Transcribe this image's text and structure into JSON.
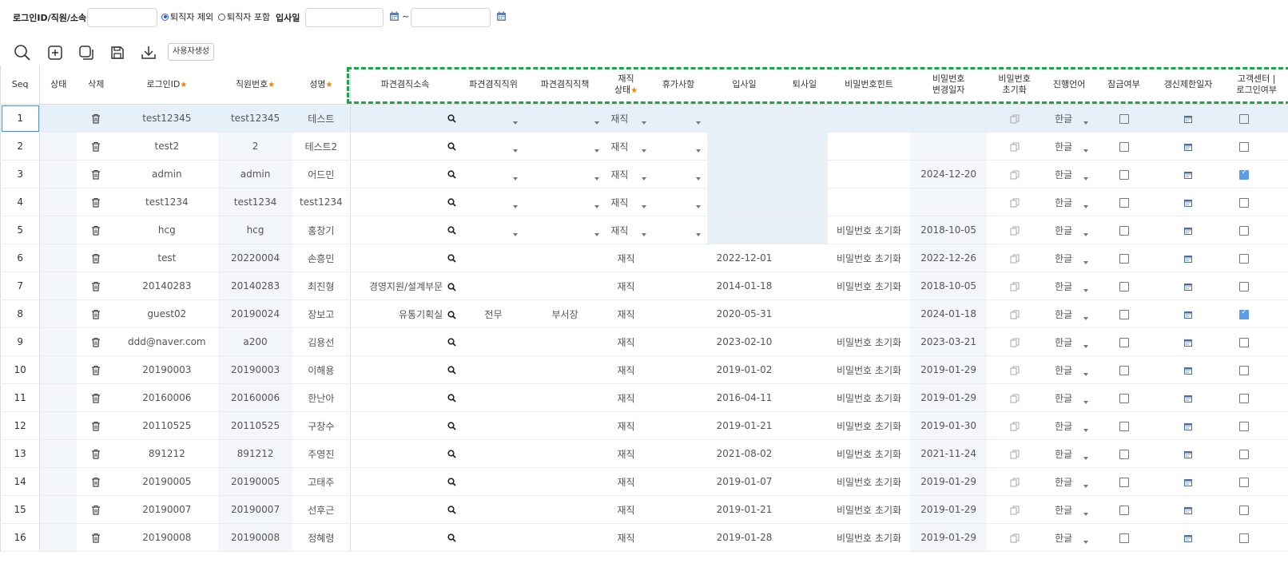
{
  "filters": {
    "login_label": "로그인ID/직원/소속",
    "login_value": "",
    "retired_exclude": "퇴직자 제외",
    "retired_include": "퇴직자 포함",
    "hire_label": "입사일",
    "date_from": "",
    "date_to": "",
    "tilde": "~"
  },
  "toolbar": {
    "create_user": "사용자생성"
  },
  "columns": {
    "seq": "Seq",
    "status": "상태",
    "delete": "삭제",
    "login_id": "로그인ID",
    "emp_no": "직원번호",
    "name": "성명",
    "dispatch_org": "파견겸직소속",
    "dispatch_pos": "파견겸직직위",
    "dispatch_duty": "파견겸직직책",
    "work_status_1": "재직",
    "work_status_2": "상태",
    "leave": "휴가사항",
    "hire_date": "입사일",
    "retire_date": "퇴사일",
    "pw_hint": "비밀번호힌트",
    "pw_changed_1": "비밀번호",
    "pw_changed_2": "변경일자",
    "pw_reset_1": "비밀번호",
    "pw_reset_2": "초기화",
    "language": "진행언어",
    "lock": "잠금여부",
    "renew_limit": "갱신제한일자",
    "cs_login_1": "고객센터 |",
    "cs_login_2": "로그인여부"
  },
  "rows": [
    {
      "seq": "1",
      "login": "test12345",
      "emp": "test12345",
      "name": "테스트",
      "org": "",
      "pos": "",
      "duty": "",
      "status": "재직",
      "hire": "",
      "hint": "",
      "pwdate": "",
      "lang": "한글",
      "cs": false,
      "editable": true
    },
    {
      "seq": "2",
      "login": "test2",
      "emp": "2",
      "name": "테스트2",
      "org": "",
      "pos": "",
      "duty": "",
      "status": "재직",
      "hire": "",
      "hint": "",
      "pwdate": "",
      "lang": "한글",
      "cs": false,
      "editable": true
    },
    {
      "seq": "3",
      "login": "admin",
      "emp": "admin",
      "name": "어드민",
      "org": "",
      "pos": "",
      "duty": "",
      "status": "재직",
      "hire": "",
      "hint": "",
      "pwdate": "2024-12-20",
      "lang": "한글",
      "cs": true,
      "editable": true
    },
    {
      "seq": "4",
      "login": "test1234",
      "emp": "test1234",
      "name": "test1234",
      "org": "",
      "pos": "",
      "duty": "",
      "status": "재직",
      "hire": "",
      "hint": "",
      "pwdate": "",
      "lang": "한글",
      "cs": false,
      "editable": true
    },
    {
      "seq": "5",
      "login": "hcg",
      "emp": "hcg",
      "name": "홍창기",
      "org": "",
      "pos": "",
      "duty": "",
      "status": "재직",
      "hire": "",
      "hint": "비밀번호 초기화",
      "pwdate": "2018-10-05",
      "lang": "한글",
      "cs": false,
      "editable": true
    },
    {
      "seq": "6",
      "login": "test",
      "emp": "20220004",
      "name": "손흥민",
      "org": "",
      "pos": "",
      "duty": "",
      "status": "재직",
      "hire": "2022-12-01",
      "hint": "비밀번호 초기화",
      "pwdate": "2022-12-26",
      "lang": "한글",
      "cs": false,
      "editable": false
    },
    {
      "seq": "7",
      "login": "20140283",
      "emp": "20140283",
      "name": "최진형",
      "org": "경영지원/설계부문",
      "pos": "",
      "duty": "",
      "status": "재직",
      "hire": "2014-01-18",
      "hint": "비밀번호 초기화",
      "pwdate": "2018-10-05",
      "lang": "한글",
      "cs": false,
      "editable": false
    },
    {
      "seq": "8",
      "login": "guest02",
      "emp": "20190024",
      "name": "장보고",
      "org": "유통기획실",
      "pos": "전무",
      "duty": "부서장",
      "status": "재직",
      "hire": "2020-05-31",
      "hint": "",
      "pwdate": "2024-01-18",
      "lang": "한글",
      "cs": true,
      "editable": false
    },
    {
      "seq": "9",
      "login": "ddd@naver.com",
      "emp": "a200",
      "name": "김용선",
      "org": "",
      "pos": "",
      "duty": "",
      "status": "재직",
      "hire": "2023-02-10",
      "hint": "비밀번호 초기화",
      "pwdate": "2023-03-21",
      "lang": "한글",
      "cs": false,
      "editable": false
    },
    {
      "seq": "10",
      "login": "20190003",
      "emp": "20190003",
      "name": "이해용",
      "org": "",
      "pos": "",
      "duty": "",
      "status": "재직",
      "hire": "2019-01-02",
      "hint": "비밀번호 초기화",
      "pwdate": "2019-01-29",
      "lang": "한글",
      "cs": false,
      "editable": false
    },
    {
      "seq": "11",
      "login": "20160006",
      "emp": "20160006",
      "name": "한난아",
      "org": "",
      "pos": "",
      "duty": "",
      "status": "재직",
      "hire": "2016-04-11",
      "hint": "비밀번호 초기화",
      "pwdate": "2019-01-29",
      "lang": "한글",
      "cs": false,
      "editable": false
    },
    {
      "seq": "12",
      "login": "20110525",
      "emp": "20110525",
      "name": "구창수",
      "org": "",
      "pos": "",
      "duty": "",
      "status": "재직",
      "hire": "2019-01-21",
      "hint": "비밀번호 초기화",
      "pwdate": "2019-01-30",
      "lang": "한글",
      "cs": false,
      "editable": false
    },
    {
      "seq": "13",
      "login": "891212",
      "emp": "891212",
      "name": "주영진",
      "org": "",
      "pos": "",
      "duty": "",
      "status": "재직",
      "hire": "2021-08-02",
      "hint": "비밀번호 초기화",
      "pwdate": "2021-11-24",
      "lang": "한글",
      "cs": false,
      "editable": false
    },
    {
      "seq": "14",
      "login": "20190005",
      "emp": "20190005",
      "name": "고태주",
      "org": "",
      "pos": "",
      "duty": "",
      "status": "재직",
      "hire": "2019-01-07",
      "hint": "비밀번호 초기화",
      "pwdate": "2019-01-29",
      "lang": "한글",
      "cs": false,
      "editable": false
    },
    {
      "seq": "15",
      "login": "20190007",
      "emp": "20190007",
      "name": "선후근",
      "org": "",
      "pos": "",
      "duty": "",
      "status": "재직",
      "hire": "2019-01-21",
      "hint": "비밀번호 초기화",
      "pwdate": "2019-01-29",
      "lang": "한글",
      "cs": false,
      "editable": false
    },
    {
      "seq": "16",
      "login": "20190008",
      "emp": "20190008",
      "name": "정혜령",
      "org": "",
      "pos": "",
      "duty": "",
      "status": "재직",
      "hire": "2019-01-28",
      "hint": "비밀번호 초기화",
      "pwdate": "2019-01-29",
      "lang": "한글",
      "cs": false,
      "editable": false
    }
  ],
  "colors": {
    "accent": "#5d9ce6",
    "highlight_border": "#1fa34a",
    "star": "#f08200",
    "selected_row": "#e6f0f8"
  }
}
